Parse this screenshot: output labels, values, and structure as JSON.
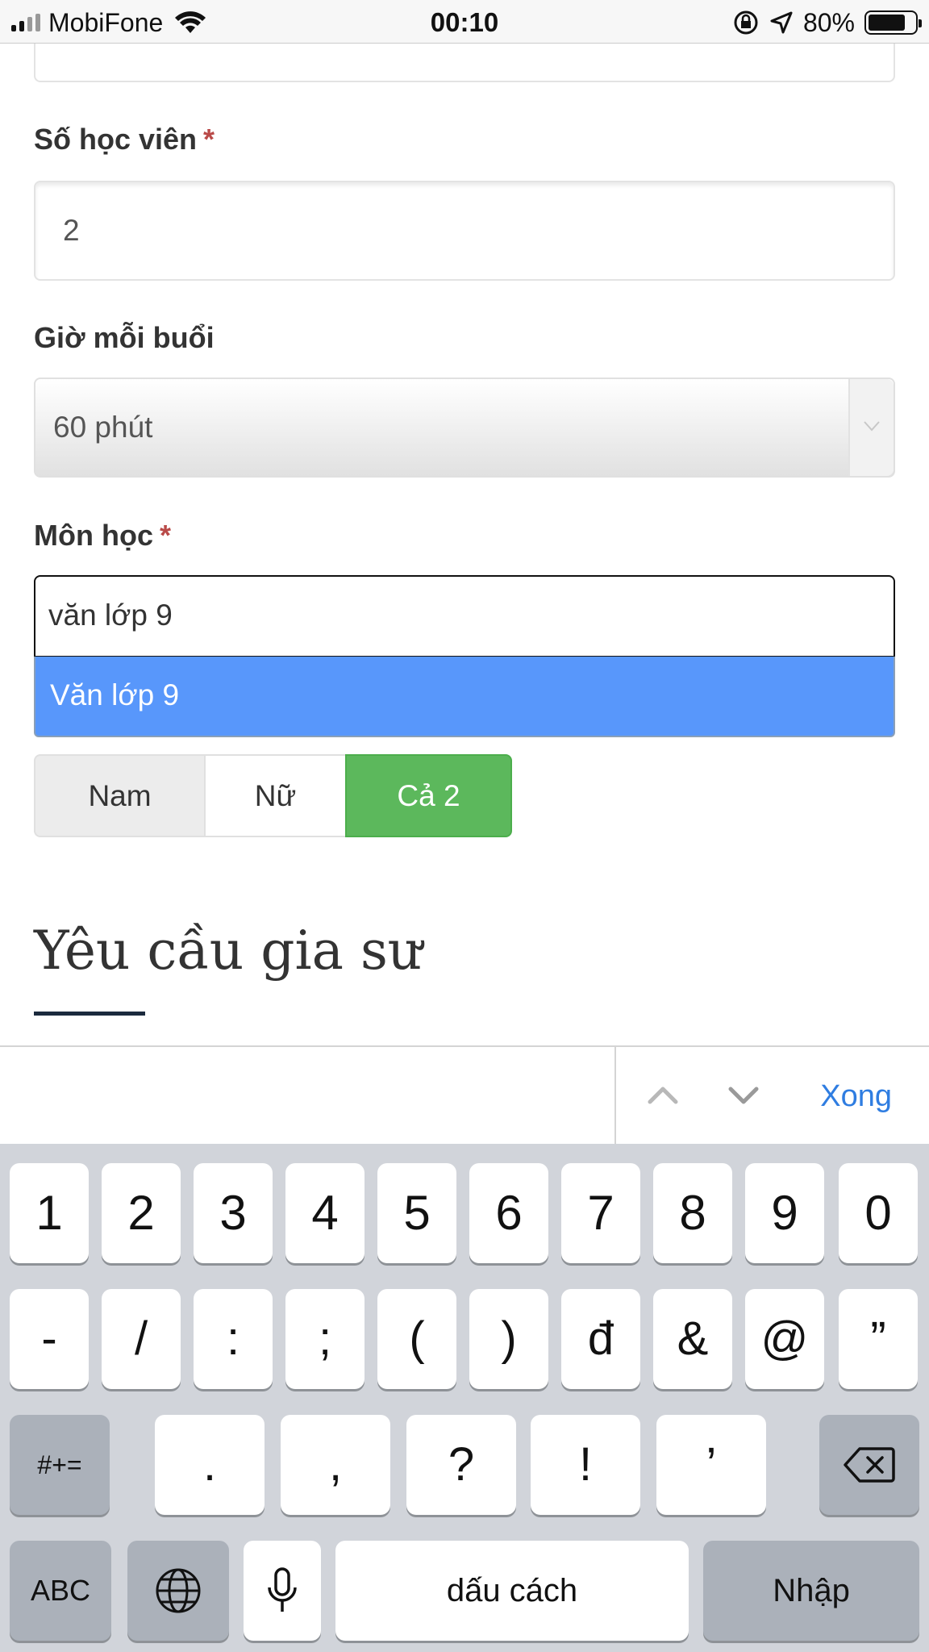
{
  "status_bar": {
    "carrier": "MobiFone",
    "time": "00:10",
    "battery_percent": "80%",
    "battery_level": 0.8
  },
  "form": {
    "students_label": "Số học viên",
    "required_mark": "*",
    "students_value": "2",
    "hours_label": "Giờ mỗi buổi",
    "hours_value": "60 phút",
    "subject_label": "Môn học",
    "subject_query": "văn lớp 9",
    "subject_option": "Văn lớp 9",
    "gender_options": [
      "Nam",
      "Nữ",
      "Cả 2"
    ],
    "gender_selected": "Cả 2"
  },
  "section": {
    "title": "Yêu cầu gia sư"
  },
  "accessory": {
    "done_label": "Xong"
  },
  "keyboard": {
    "row1": [
      "1",
      "2",
      "3",
      "4",
      "5",
      "6",
      "7",
      "8",
      "9",
      "0"
    ],
    "row2": [
      "-",
      "/",
      ":",
      ";",
      "(",
      ")",
      "đ",
      "&",
      "@",
      "”"
    ],
    "row3": [
      ".",
      ",",
      "?",
      "!",
      "’"
    ],
    "more_symbols": "#+=",
    "abc": "ABC",
    "space": "dấu cách",
    "return": "Nhập"
  },
  "colors": {
    "selected_option": "#5897fb",
    "gender_active": "#5cb85c",
    "required": "#b94a48",
    "link_blue": "#2f7de1"
  }
}
